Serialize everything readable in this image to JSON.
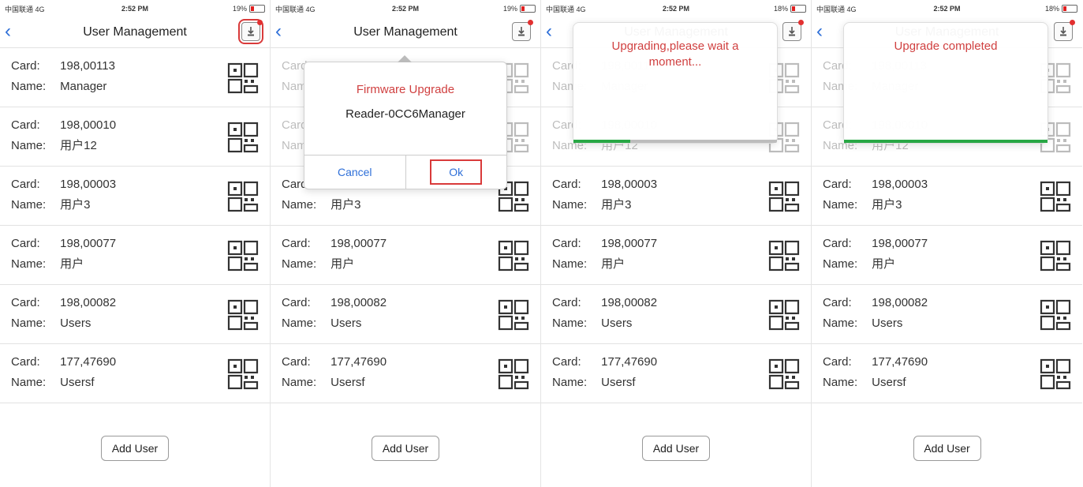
{
  "status_bar": {
    "carrier": "中国联通  4G",
    "time": "2:52 PM",
    "battery": [
      "19%",
      "19%",
      "18%",
      "18%"
    ]
  },
  "nav": {
    "title": "User Management",
    "back_icon": "chevron-left-icon",
    "upgrade_icon": "firmware-upgrade-icon"
  },
  "labels": {
    "card": "Card:",
    "name": "Name:"
  },
  "users": [
    {
      "card": "198,00113",
      "name": "Manager"
    },
    {
      "card": "198,00010",
      "name": "用户12"
    },
    {
      "card": "198,00003",
      "name": "用户3"
    },
    {
      "card": "198,00077",
      "name": "用户"
    },
    {
      "card": "198,00082",
      "name": "Users"
    },
    {
      "card": "177,47690",
      "name": "Usersf"
    }
  ],
  "add_user_label": "Add User",
  "dialog": {
    "title": "Firmware Upgrade",
    "device": "Reader-0CC6Manager",
    "cancel": "Cancel",
    "ok": "Ok"
  },
  "upgrading": {
    "message": "Upgrading,please wait a moment...",
    "progress": 0.28
  },
  "completed": {
    "message": "Upgrade completed",
    "progress": 1.0
  },
  "colors": {
    "accent": "#2e6fd8",
    "alert": "#d04040",
    "progress": "#28a745"
  }
}
